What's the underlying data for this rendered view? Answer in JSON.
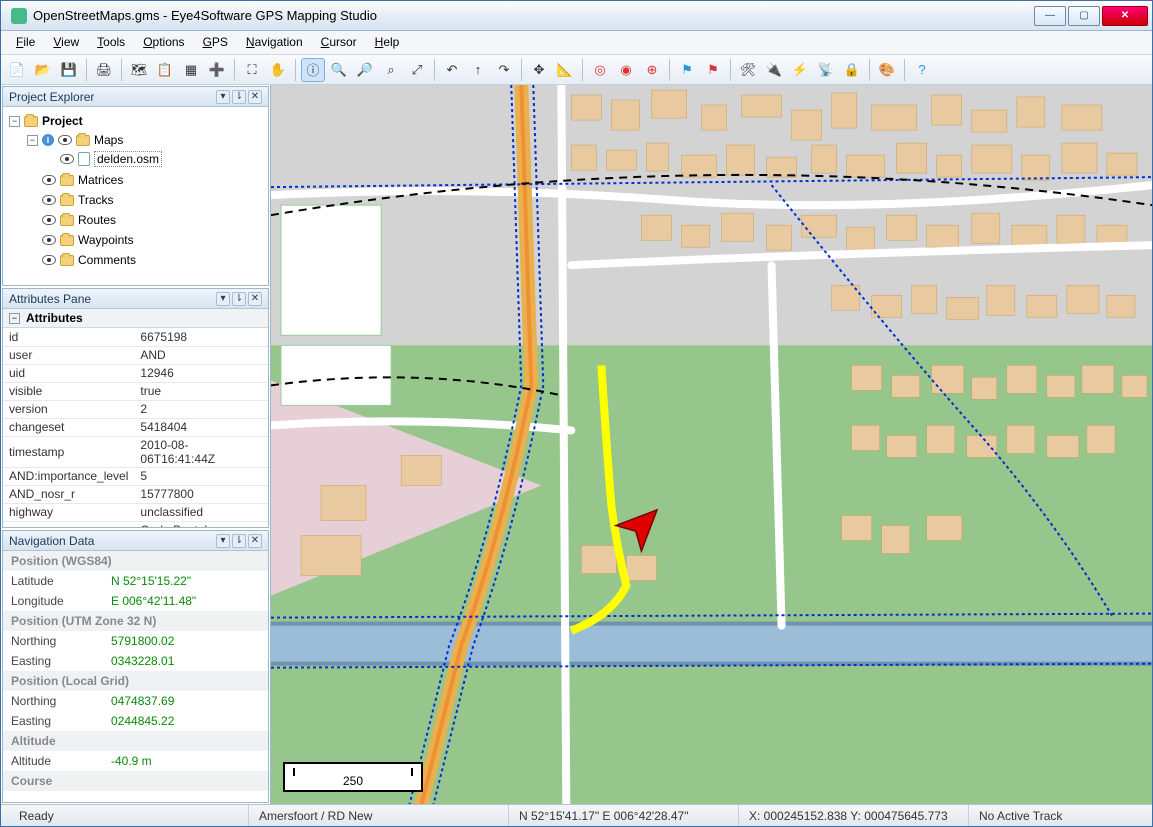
{
  "window": {
    "title": "OpenStreetMaps.gms - Eye4Software GPS Mapping Studio"
  },
  "menu": [
    "File",
    "View",
    "Tools",
    "Options",
    "GPS",
    "Navigation",
    "Cursor",
    "Help"
  ],
  "projectExplorer": {
    "title": "Project Explorer",
    "root": "Project",
    "nodes": {
      "maps": "Maps",
      "file": "delden.osm",
      "matrices": "Matrices",
      "tracks": "Tracks",
      "routes": "Routes",
      "waypoints": "Waypoints",
      "comments": "Comments"
    }
  },
  "attributesPane": {
    "title": "Attributes Pane",
    "header": "Attributes",
    "rows": [
      {
        "k": "id",
        "v": "6675198"
      },
      {
        "k": "user",
        "v": "AND"
      },
      {
        "k": "uid",
        "v": "12946"
      },
      {
        "k": "visible",
        "v": "true"
      },
      {
        "k": "version",
        "v": "2"
      },
      {
        "k": "changeset",
        "v": "5418404"
      },
      {
        "k": "timestamp",
        "v": "2010-08-06T16:41:44Z"
      },
      {
        "k": "AND:importance_level",
        "v": "5"
      },
      {
        "k": "AND_nosr_r",
        "v": "15777800"
      },
      {
        "k": "highway",
        "v": "unclassified"
      },
      {
        "k": "name",
        "v": "Oude Benteloseweg"
      }
    ]
  },
  "navData": {
    "title": "Navigation Data",
    "sections": [
      {
        "header": "Position (WGS84)",
        "rows": [
          {
            "k": "Latitude",
            "v": "N 52°15'15.22\""
          },
          {
            "k": "Longitude",
            "v": "E 006°42'11.48\""
          }
        ]
      },
      {
        "header": "Position (UTM Zone 32 N)",
        "rows": [
          {
            "k": "Northing",
            "v": "5791800.02"
          },
          {
            "k": "Easting",
            "v": "0343228.01"
          }
        ]
      },
      {
        "header": "Position (Local Grid)",
        "rows": [
          {
            "k": "Northing",
            "v": "0474837.69"
          },
          {
            "k": "Easting",
            "v": "0244845.22"
          }
        ]
      },
      {
        "header": "Altitude",
        "rows": [
          {
            "k": "Altitude",
            "v": "-40.9 m"
          }
        ]
      },
      {
        "header": "Course",
        "rows": []
      }
    ]
  },
  "scale": "250",
  "status": {
    "ready": "Ready",
    "proj": "Amersfoort / RD New",
    "coord": "N 52°15'41.17\" E 006°42'28.47\"",
    "xy": "X: 000245152.838 Y: 000475645.773",
    "track": "No Active Track"
  }
}
